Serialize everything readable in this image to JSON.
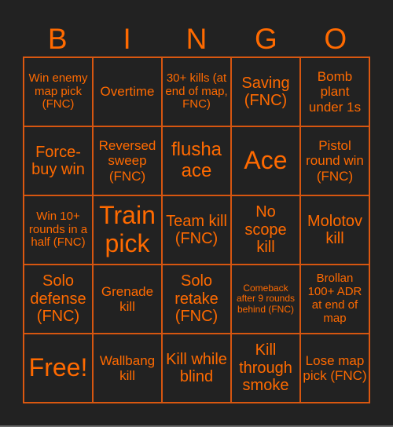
{
  "header": {
    "letters": [
      "B",
      "I",
      "N",
      "G",
      "O"
    ]
  },
  "accent_color": "#ff6a00",
  "cells": [
    [
      "Win enemy map pick (FNC)",
      "Overtime",
      "30+ kills (at end of map, FNC)",
      "Saving (FNC)",
      "Bomb plant under 1s"
    ],
    [
      "Force-buy win",
      "Reversed sweep (FNC)",
      "flusha ace",
      "Ace",
      "Pistol round win (FNC)"
    ],
    [
      "Win 10+ rounds in a half (FNC)",
      "Train pick",
      "Team kill (FNC)",
      "No scope kill",
      "Molotov kill"
    ],
    [
      "Solo defense (FNC)",
      "Grenade kill",
      "Solo retake (FNC)",
      "Comeback after 9 rounds behind (FNC)",
      "Brollan 100+ ADR at end of map"
    ],
    [
      "Free!",
      "Wallbang kill",
      "Kill while blind",
      "Kill through smoke",
      "Lose map pick (FNC)"
    ]
  ]
}
